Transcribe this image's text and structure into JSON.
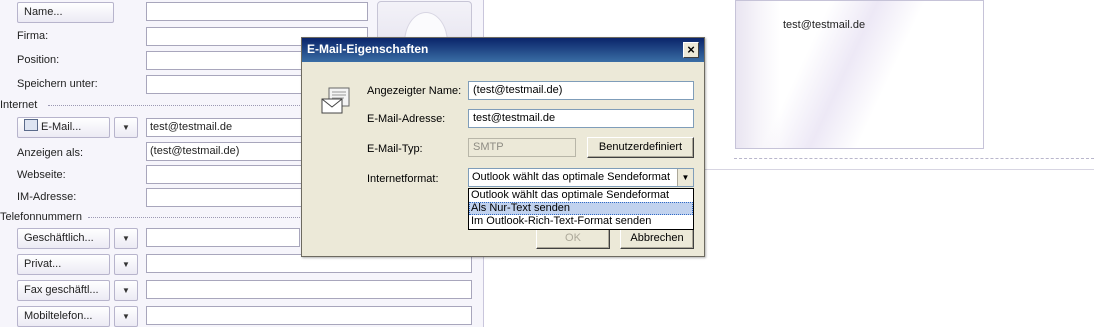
{
  "form": {
    "buttons": {
      "name": "Name...",
      "email": "E-Mail...",
      "phone_business": "Geschäftlich...",
      "phone_private": "Privat...",
      "fax_business": "Fax geschäftl...",
      "mobile": "Mobiltelefon..."
    },
    "labels": {
      "company": "Firma:",
      "position": "Position:",
      "save_as": "Speichern unter:",
      "display_as": "Anzeigen als:",
      "website": "Webseite:",
      "im_address": "IM-Adresse:"
    },
    "sections": {
      "internet": "Internet",
      "phone_numbers": "Telefonnummern"
    },
    "values": {
      "email": "test@testmail.de",
      "display_as": "(test@testmail.de)"
    }
  },
  "business_card": {
    "email": "test@testmail.de"
  },
  "dialog": {
    "title": "E-Mail-Eigenschaften",
    "close": "×",
    "labels": {
      "display_name": "Angezeigter Name:",
      "email_address": "E-Mail-Adresse:",
      "email_type": "E-Mail-Typ:",
      "internet_format": "Internetformat:"
    },
    "values": {
      "display_name": "(test@testmail.de)",
      "email_address": "test@testmail.de",
      "email_type": "SMTP",
      "internet_format": "Outlook wählt das optimale Sendeformat"
    },
    "buttons": {
      "custom": "Benutzerdefiniert",
      "ok": "OK",
      "cancel": "Abbrechen"
    },
    "format_options": [
      "Outlook wählt das optimale Sendeformat",
      "Als Nur-Text senden",
      "Im Outlook-Rich-Text-Format senden"
    ],
    "selected_option_index": 1
  },
  "colors": {
    "titlebar": "#0a246a",
    "dialog_bg": "#ece9d8",
    "selection": "#c1d2ee"
  }
}
